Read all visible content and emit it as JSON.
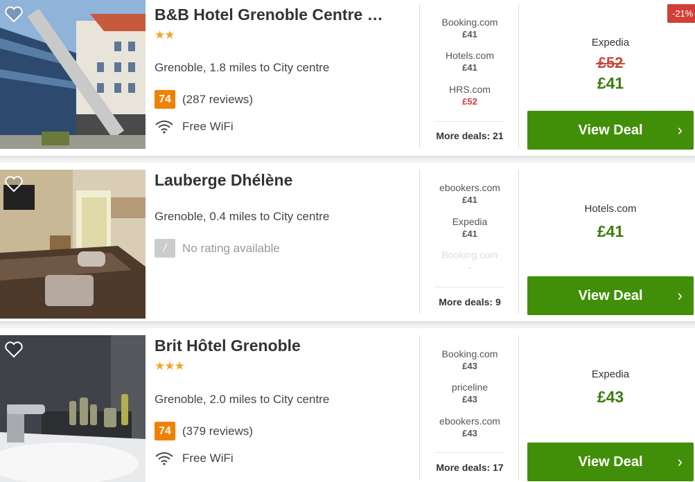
{
  "hotels": [
    {
      "name": "B&B Hotel Grenoble Centre …",
      "stars": "★★",
      "location": "Grenoble, 1.8 miles to City centre",
      "score": "74",
      "reviews": "(287 reviews)",
      "amenity": "Free WiFi",
      "deals": [
        {
          "provider": "Booking.com",
          "price": "£41"
        },
        {
          "provider": "Hotels.com",
          "price": "£41"
        },
        {
          "provider": "HRS.com",
          "price": "£52"
        }
      ],
      "more_deals": "More deals: 21",
      "main_provider": "Expedia",
      "old_price": "£52",
      "price": "£41",
      "button": "View Deal",
      "discount": "-21%"
    },
    {
      "name": "Lauberge Dhélène",
      "location": "Grenoble, 0.4 miles to City centre",
      "score": "/",
      "reviews": "No rating available",
      "deals": [
        {
          "provider": "ebookers.com",
          "price": "£41"
        },
        {
          "provider": "Expedia",
          "price": "£41"
        },
        {
          "provider": "Booking.com",
          "price": "-"
        }
      ],
      "more_deals": "More deals: 9",
      "main_provider": "Hotels.com",
      "price": "£41",
      "button": "View Deal"
    },
    {
      "name": "Brit Hôtel Grenoble",
      "stars": "★★★",
      "location": "Grenoble, 2.0 miles to City centre",
      "score": "74",
      "reviews": "(379 reviews)",
      "amenity": "Free WiFi",
      "deals": [
        {
          "provider": "Booking.com",
          "price": "£43"
        },
        {
          "provider": "priceline",
          "price": "£43"
        },
        {
          "provider": "ebookers.com",
          "price": "£43"
        }
      ],
      "more_deals": "More deals: 17",
      "main_provider": "Expedia",
      "price": "£43",
      "button": "View Deal"
    }
  ],
  "icons": {
    "favorite": "heart-outline-icon",
    "wifi": "wifi-icon",
    "chevron": "chevron-right-icon"
  },
  "colors": {
    "button_green": "#418f08",
    "price_green": "#3a7e0f",
    "score_orange": "#f08100",
    "discount_red": "#d03f38",
    "star_gold": "#f3a52a"
  }
}
